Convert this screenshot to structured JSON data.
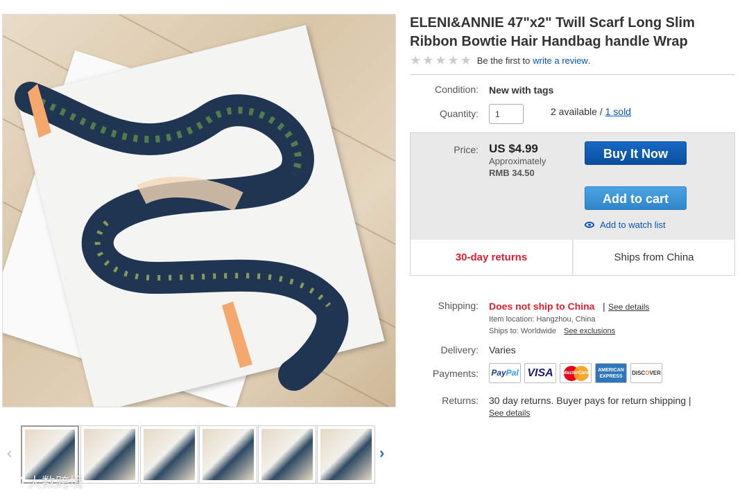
{
  "product": {
    "title": "ELENI&ANNIE 47\"x2\" Twill Scarf Long Slim Ribbon Bowtie Hair Handbag handle Wrap",
    "rating": {
      "stars_filled": 0,
      "stars_total": 5,
      "review_prefix": "Be the first to",
      "review_link": "write a review",
      "review_suffix": "."
    }
  },
  "details": {
    "condition_label": "Condition:",
    "condition_value": "New with tags",
    "quantity_label": "Quantity:",
    "quantity_value": "1",
    "available_text": "2 available /",
    "sold_link": "1 sold"
  },
  "price_box": {
    "price_label": "Price:",
    "price_value": "US $4.99",
    "approx_label": "Approximately",
    "converted_price": "RMB 34.50",
    "buy_now_label": "Buy It Now",
    "add_to_cart_label": "Add to cart",
    "watch_label": "Add to watch list",
    "returns_badge": "30-day returns",
    "ships_from": "Ships from China"
  },
  "shipping": {
    "shipping_label": "Shipping:",
    "status": "Does not ship to China",
    "separator": "|",
    "see_details": "See details",
    "item_location": "Item location:  Hangzhou, China",
    "ships_to_prefix": "Ships to:  Worldwide",
    "see_exclusions": "See exclusions"
  },
  "delivery": {
    "label": "Delivery:",
    "value": "Varies"
  },
  "payments": {
    "label": "Payments:",
    "methods": [
      "PayPal",
      "VISA",
      "MasterCard",
      "AMERICAN EXPRESS",
      "DISCOVER"
    ],
    "paypal_a": "Pay",
    "paypal_b": "Pal",
    "visa": "VISA",
    "mastercard": "MasterCard",
    "amex_line1": "AMERICAN",
    "amex_line2": "EXPRESS",
    "discover_a": "DISC",
    "discover_b": "O",
    "discover_c": "VER"
  },
  "returns": {
    "label": "Returns:",
    "text": "30 day returns. Buyer pays for return shipping |",
    "see_details": "See details"
  },
  "gallery": {
    "thumbnail_count": 6,
    "selected_index": 0,
    "prev_icon": "chevron-left-icon",
    "next_icon": "chevron-right-icon",
    "prev_glyph": "‹",
    "next_glyph": "›"
  },
  "watermark": {
    "text": "大数跨境"
  },
  "colors": {
    "link": "#0654ba",
    "alert_red": "#dd1e31",
    "buy_now_blue": "#0a4f9e",
    "add_cart_blue": "#3b93d4",
    "price_box_bg": "#e9e9e9"
  }
}
